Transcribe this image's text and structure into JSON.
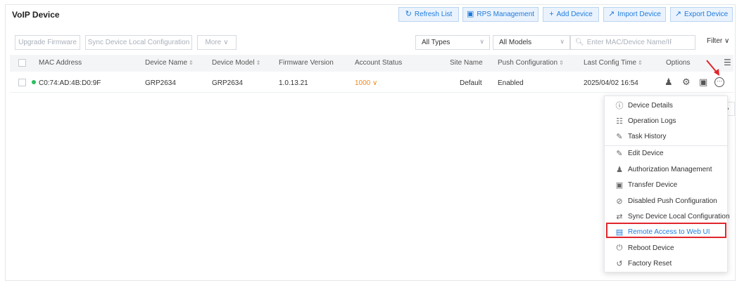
{
  "page": {
    "title": "VoIP Device"
  },
  "header_actions": [
    {
      "label": "Refresh List",
      "icon": "refresh-icon"
    },
    {
      "label": "RPS Management",
      "icon": "rps-icon"
    },
    {
      "label": "Add Device",
      "icon": "plus-icon"
    },
    {
      "label": "Import Device",
      "icon": "import-icon"
    },
    {
      "label": "Export Device",
      "icon": "export-icon"
    }
  ],
  "toolbar": {
    "upgrade_firmware": "Upgrade Firmware",
    "sync_config": "Sync Device Local Configuration",
    "more": "More",
    "type_select": "All Types",
    "model_select": "All Models",
    "search_placeholder": "Enter MAC/Device Name/IP",
    "filter": "Filter"
  },
  "table": {
    "columns": {
      "mac": "MAC Address",
      "name": "Device Name",
      "model": "Device Model",
      "firmware": "Firmware Version",
      "account": "Account Status",
      "site": "Site Name",
      "push": "Push Configuration",
      "last_config": "Last Config Time",
      "options": "Options"
    },
    "rows": [
      {
        "mac": "C0:74:AD:4B:D0:9F",
        "name": "GRP2634",
        "model": "GRP2634",
        "firmware": "1.0.13.21",
        "account": "1000",
        "site": "Default",
        "push": "Enabled",
        "last_config": "2025/04/02 16:54",
        "status_color": "#2dbd5f"
      }
    ]
  },
  "menu": {
    "items": [
      {
        "label": "Device Details",
        "icon": "info-icon"
      },
      {
        "label": "Operation Logs",
        "icon": "log-icon"
      },
      {
        "label": "Task History",
        "icon": "task-history-icon"
      },
      {
        "label": "Edit Device",
        "icon": "edit-icon"
      },
      {
        "label": "Authorization Management",
        "icon": "authorization-icon"
      },
      {
        "label": "Transfer Device",
        "icon": "transfer-icon"
      },
      {
        "label": "Disabled Push Configuration",
        "icon": "disable-push-icon"
      },
      {
        "label": "Sync Device Local Configuration",
        "icon": "sync-config-icon"
      },
      {
        "label": "Remote Access to Web UI",
        "icon": "remote-access-icon",
        "highlighted": true
      },
      {
        "label": "Reboot Device",
        "icon": "power-icon"
      },
      {
        "label": "Factory Reset",
        "icon": "reset-icon"
      }
    ]
  },
  "colors": {
    "accent": "#1f7bdc",
    "online": "#2dbd5f",
    "account": "#f08a1c",
    "highlight": "#e0262b"
  }
}
